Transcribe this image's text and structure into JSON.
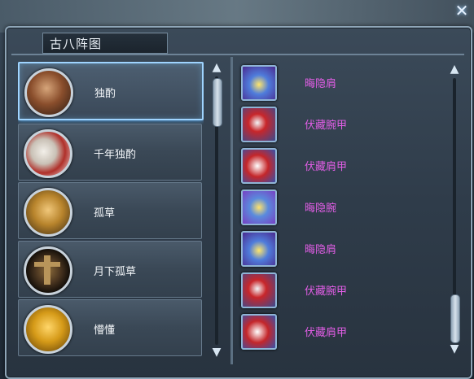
{
  "window": {
    "title": "古八阵图",
    "close_icon": "close-icon"
  },
  "characters": [
    {
      "name": "独酌",
      "avatar_icon": "warrior-portrait-icon",
      "selected": true
    },
    {
      "name": "千年独酌",
      "avatar_icon": "white-haired-warrior-icon",
      "selected": false
    },
    {
      "name": "孤草",
      "avatar_icon": "golden-helmet-warrior-icon",
      "selected": false
    },
    {
      "name": "月下孤草",
      "avatar_icon": "cross-totem-icon",
      "selected": false
    },
    {
      "name": "懵懂",
      "avatar_icon": "golden-armor-warrior-icon",
      "selected": false
    }
  ],
  "equipment": [
    {
      "name": "晦隐肩",
      "icon": "pauldron-icon"
    },
    {
      "name": "伏藏腕甲",
      "icon": "bracer-icon"
    },
    {
      "name": "伏藏肩甲",
      "icon": "shoulder-armor-icon"
    },
    {
      "name": "晦隐腕",
      "icon": "wrist-guard-icon"
    },
    {
      "name": "晦隐肩",
      "icon": "pauldron-icon"
    },
    {
      "name": "伏藏腕甲",
      "icon": "bracer-icon"
    },
    {
      "name": "伏藏肩甲",
      "icon": "shoulder-armor-icon"
    }
  ],
  "colors": {
    "equipment_text": "#e25ee6",
    "selection_glow": "#9fd4ff"
  }
}
